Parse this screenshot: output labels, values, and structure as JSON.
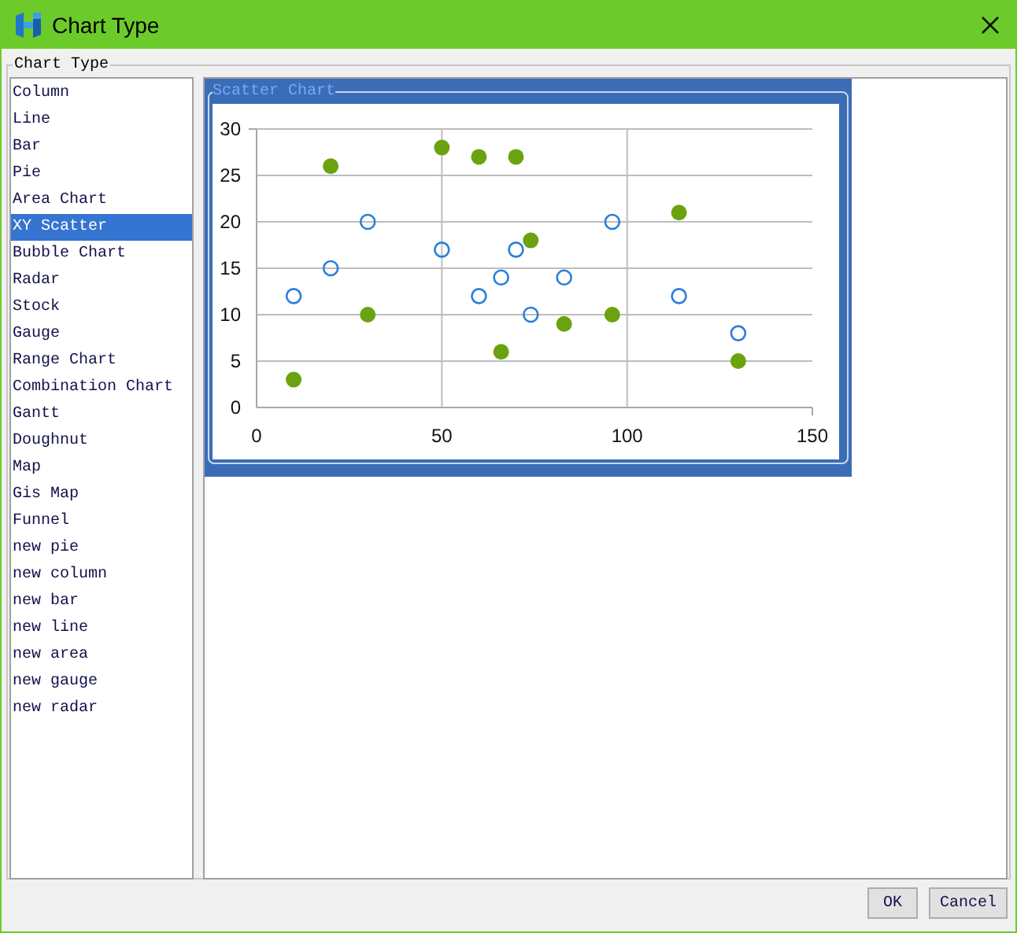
{
  "window": {
    "title": "Chart Type"
  },
  "chart_type_group": {
    "label": "Chart Type"
  },
  "chart_types": [
    {
      "label": "Column",
      "selected": false
    },
    {
      "label": "Line",
      "selected": false
    },
    {
      "label": "Bar",
      "selected": false
    },
    {
      "label": "Pie",
      "selected": false
    },
    {
      "label": "Area Chart",
      "selected": false
    },
    {
      "label": "XY Scatter",
      "selected": true
    },
    {
      "label": "Bubble Chart",
      "selected": false
    },
    {
      "label": "Radar",
      "selected": false
    },
    {
      "label": "Stock",
      "selected": false
    },
    {
      "label": "Gauge",
      "selected": false
    },
    {
      "label": "Range Chart",
      "selected": false
    },
    {
      "label": "Combination Chart",
      "selected": false
    },
    {
      "label": "Gantt",
      "selected": false
    },
    {
      "label": "Doughnut",
      "selected": false
    },
    {
      "label": "Map",
      "selected": false
    },
    {
      "label": "Gis Map",
      "selected": false
    },
    {
      "label": "Funnel",
      "selected": false
    },
    {
      "label": "new pie",
      "selected": false
    },
    {
      "label": "new column",
      "selected": false
    },
    {
      "label": "new bar",
      "selected": false
    },
    {
      "label": "new line",
      "selected": false
    },
    {
      "label": "new area",
      "selected": false
    },
    {
      "label": "new gauge",
      "selected": false
    },
    {
      "label": "new radar",
      "selected": false
    }
  ],
  "preview": {
    "chart_data": {
      "type": "scatter",
      "title": "Scatter Chart",
      "x": [
        10,
        20,
        30,
        50,
        60,
        66,
        70,
        74,
        83,
        96,
        114,
        130
      ],
      "series": [
        {
          "color": "#6aa30f",
          "marker": "circle",
          "values": [
            3,
            26,
            10,
            28,
            27,
            6,
            27,
            18,
            9,
            10,
            21,
            5
          ]
        },
        {
          "color": "#2a7fd8",
          "marker": "circle",
          "values": [
            12,
            15,
            20,
            17,
            12,
            14,
            17,
            10,
            14,
            20,
            12,
            8
          ]
        }
      ],
      "xlim": [
        0,
        150
      ],
      "ylim": [
        0,
        30
      ],
      "xticks": [
        0,
        50,
        100,
        150
      ],
      "yticks": [
        0,
        5,
        10,
        15,
        20,
        25,
        30
      ],
      "grid": true
    }
  },
  "buttons": [
    {
      "label": "OK"
    },
    {
      "label": "Cancel"
    }
  ]
}
